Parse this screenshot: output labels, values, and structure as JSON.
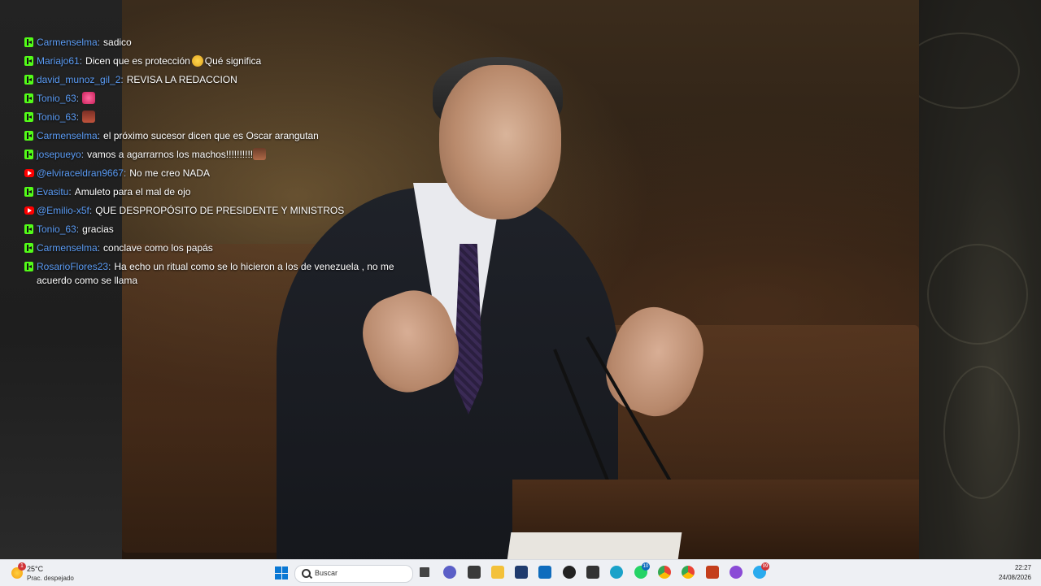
{
  "chat": {
    "messages": [
      {
        "platform": "kick",
        "user": "Carmenselma",
        "text": "sadico"
      },
      {
        "platform": "kick",
        "user": "Mariajo61",
        "text": "Dicen que es protección",
        "emote": "thinking-face",
        "text2": "Qué significa"
      },
      {
        "platform": "kick",
        "user": "david_munoz_gil_2",
        "text": "REVISA LA REDACCION"
      },
      {
        "platform": "kick",
        "user": "Tonio_63",
        "text": "",
        "emote": "emote-heart-sparkle"
      },
      {
        "platform": "kick",
        "user": "Tonio_63",
        "text": "",
        "emote": "emote-face"
      },
      {
        "platform": "kick",
        "user": "Carmenselma",
        "text": "el próximo sucesor dicen que es Oscar arangutan"
      },
      {
        "platform": "kick",
        "user": "josepueyo",
        "text": "vamos a agarrarnos los machos!!!!!!!!!!",
        "emote": "emote-face-2"
      },
      {
        "platform": "youtube",
        "user": "@elviraceldran9667",
        "text": "No me creo NADA"
      },
      {
        "platform": "kick",
        "user": "Evasitu",
        "text": "Amuleto para el mal de ojo"
      },
      {
        "platform": "youtube",
        "user": "@Emilio-x5f",
        "text": "QUE DESPROPÓSITO DE PRESIDENTE Y MINISTROS"
      },
      {
        "platform": "kick",
        "user": "Tonio_63",
        "text": "gracias"
      },
      {
        "platform": "kick",
        "user": "Carmenselma",
        "text": "conclave como los papás"
      },
      {
        "platform": "kick",
        "user": "RosarioFlores23",
        "text": "Ha echo un ritual como se lo hicieron a los de venezuela , no me acuerdo como se llama"
      }
    ]
  },
  "taskbar": {
    "weather": {
      "temp": "25°C",
      "condition": "Prac. despejado",
      "badge": "1"
    },
    "search_placeholder": "Buscar",
    "time": "22:27",
    "date": "24/08/2026",
    "badges": {
      "whatsapp": "10",
      "misc": "99"
    }
  },
  "colors": {
    "kick": "#53fc18",
    "youtube": "#ff0000",
    "username": "#5b9cf5",
    "taskbar": "#eef0f4"
  }
}
